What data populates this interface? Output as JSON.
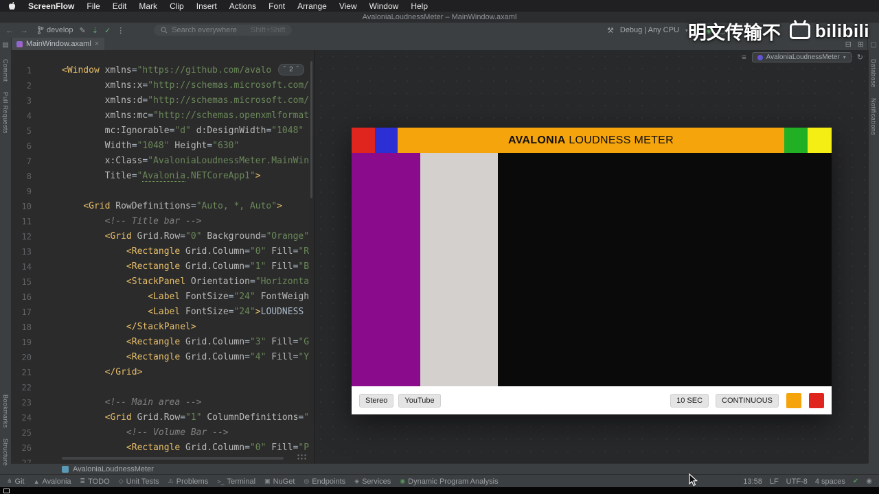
{
  "menubar": {
    "app": "ScreenFlow",
    "items": [
      "File",
      "Edit",
      "Mark",
      "Clip",
      "Insert",
      "Actions",
      "Font",
      "Arrange",
      "View",
      "Window",
      "Help"
    ]
  },
  "titlebar": {
    "title": "AvaloniaLoudnessMeter – MainWindow.axaml"
  },
  "toolbar": {
    "branch": "develop",
    "search_placeholder": "Search everywhere",
    "search_shortcut": "Shift+Shift",
    "run_config": "Debug | Any CPU"
  },
  "tab": {
    "label": "MainWindow.axaml",
    "close": "×"
  },
  "inspections": {
    "count": "2"
  },
  "strips": {
    "left_top": [
      "Commit",
      "Pull Requests"
    ],
    "left_bottom": [
      "Bookmarks",
      "Structure"
    ],
    "right": [
      "Database",
      "Notifications"
    ]
  },
  "preview": {
    "selector": "AvaloniaLoudnessMeter"
  },
  "breadcrumb": {
    "project": "AvaloniaLoudnessMeter"
  },
  "watermark": {
    "text": "明文传输不",
    "brand": "bilibili"
  },
  "statusbar": {
    "items": [
      {
        "icon": "⋔",
        "label": "Git"
      },
      {
        "icon": "▲",
        "label": "Avalonia"
      },
      {
        "icon": "≣",
        "label": "TODO"
      },
      {
        "icon": "◇",
        "label": "Unit Tests"
      },
      {
        "icon": "⚠",
        "label": "Problems"
      },
      {
        "icon": ">_",
        "label": "Terminal"
      },
      {
        "icon": "▣",
        "label": "NuGet"
      },
      {
        "icon": "◎",
        "label": "Endpoints"
      },
      {
        "icon": "◈",
        "label": "Services"
      },
      {
        "icon": "◉",
        "label": "Dynamic Program Analysis"
      }
    ],
    "time": "13:58",
    "line_ending": "LF",
    "encoding": "UTF-8",
    "indent": "4 spaces"
  },
  "app": {
    "title_strong": "AVALONIA",
    "title_rest": " LOUDNESS METER",
    "left_buttons": [
      "Stereo",
      "YouTube"
    ],
    "right_buttons": [
      "10 SEC",
      "CONTINUOUS"
    ],
    "colors": {
      "red": "#e0251f",
      "blue": "#2b2fd4",
      "orange": "#f5a40b",
      "green": "#21b024",
      "yellow": "#f4ee15",
      "purple": "#8a0c8d",
      "lightgray": "#d4d0cd",
      "black": "#0a0a0a"
    }
  },
  "code": {
    "lines": [
      {
        "n": "1",
        "t": [
          [
            "t",
            "<Window "
          ],
          [
            "a",
            "xmlns"
          ],
          [
            "p",
            "="
          ],
          [
            "s",
            "\"https://github.com/avalo"
          ]
        ]
      },
      {
        "n": "2",
        "t": [
          [
            "w",
            "        "
          ],
          [
            "a",
            "xmlns:x"
          ],
          [
            "p",
            "="
          ],
          [
            "s",
            "\"http://schemas.microsoft.com/"
          ]
        ]
      },
      {
        "n": "3",
        "t": [
          [
            "w",
            "        "
          ],
          [
            "a",
            "xmlns:d"
          ],
          [
            "p",
            "="
          ],
          [
            "s",
            "\"http://schemas.microsoft.com/"
          ]
        ]
      },
      {
        "n": "4",
        "t": [
          [
            "w",
            "        "
          ],
          [
            "a",
            "xmlns:mc"
          ],
          [
            "p",
            "="
          ],
          [
            "s",
            "\"http://schemas.openxmlformat"
          ]
        ]
      },
      {
        "n": "5",
        "t": [
          [
            "w",
            "        "
          ],
          [
            "a",
            "mc:Ignorable"
          ],
          [
            "p",
            "="
          ],
          [
            "s",
            "\"d\""
          ],
          [
            "w",
            " "
          ],
          [
            "a",
            "d:DesignWidth"
          ],
          [
            "p",
            "="
          ],
          [
            "s",
            "\"1048\""
          ]
        ]
      },
      {
        "n": "6",
        "t": [
          [
            "w",
            "        "
          ],
          [
            "a",
            "Width"
          ],
          [
            "p",
            "="
          ],
          [
            "s",
            "\"1048\""
          ],
          [
            "w",
            " "
          ],
          [
            "a",
            "Height"
          ],
          [
            "p",
            "="
          ],
          [
            "s",
            "\"630\""
          ]
        ]
      },
      {
        "n": "7",
        "t": [
          [
            "w",
            "        "
          ],
          [
            "a",
            "x:Class"
          ],
          [
            "p",
            "="
          ],
          [
            "s",
            "\"AvaloniaLoudnessMeter.MainWin"
          ]
        ]
      },
      {
        "n": "8",
        "t": [
          [
            "w",
            "        "
          ],
          [
            "a",
            "Title"
          ],
          [
            "p",
            "="
          ],
          [
            "s",
            "\""
          ],
          [
            "su",
            "Avalonia"
          ],
          [
            "s",
            ".NETCoreApp1\""
          ],
          [
            "t",
            ">"
          ]
        ]
      },
      {
        "n": "9",
        "t": []
      },
      {
        "n": "10",
        "t": [
          [
            "w",
            "    "
          ],
          [
            "t",
            "<Grid "
          ],
          [
            "a",
            "RowDefinitions"
          ],
          [
            "p",
            "="
          ],
          [
            "s",
            "\"Auto, *, Auto\""
          ],
          [
            "t",
            ">"
          ]
        ]
      },
      {
        "n": "11",
        "t": [
          [
            "w",
            "        "
          ],
          [
            "c",
            "<!-- Title bar -->"
          ]
        ]
      },
      {
        "n": "12",
        "t": [
          [
            "w",
            "        "
          ],
          [
            "t",
            "<Grid "
          ],
          [
            "a",
            "Grid.Row"
          ],
          [
            "p",
            "="
          ],
          [
            "s",
            "\"0\""
          ],
          [
            "w",
            " "
          ],
          [
            "a",
            "Background"
          ],
          [
            "p",
            "="
          ],
          [
            "s",
            "\"Orange\""
          ]
        ]
      },
      {
        "n": "13",
        "t": [
          [
            "w",
            "            "
          ],
          [
            "t",
            "<Rectangle "
          ],
          [
            "a",
            "Grid.Column"
          ],
          [
            "p",
            "="
          ],
          [
            "s",
            "\"0\""
          ],
          [
            "w",
            " "
          ],
          [
            "a",
            "Fill"
          ],
          [
            "p",
            "="
          ],
          [
            "s",
            "\"R"
          ]
        ]
      },
      {
        "n": "14",
        "t": [
          [
            "w",
            "            "
          ],
          [
            "t",
            "<Rectangle "
          ],
          [
            "a",
            "Grid.Column"
          ],
          [
            "p",
            "="
          ],
          [
            "s",
            "\"1\""
          ],
          [
            "w",
            " "
          ],
          [
            "a",
            "Fill"
          ],
          [
            "p",
            "="
          ],
          [
            "s",
            "\"B"
          ]
        ]
      },
      {
        "n": "15",
        "t": [
          [
            "w",
            "            "
          ],
          [
            "t",
            "<StackPanel "
          ],
          [
            "a",
            "Orientation"
          ],
          [
            "p",
            "="
          ],
          [
            "s",
            "\"Horizonta"
          ]
        ]
      },
      {
        "n": "16",
        "t": [
          [
            "w",
            "                "
          ],
          [
            "t",
            "<Label "
          ],
          [
            "a",
            "FontSize"
          ],
          [
            "p",
            "="
          ],
          [
            "s",
            "\"24\""
          ],
          [
            "w",
            " "
          ],
          [
            "a",
            "FontWeigh"
          ]
        ]
      },
      {
        "n": "17",
        "t": [
          [
            "w",
            "                "
          ],
          [
            "t",
            "<Label "
          ],
          [
            "a",
            "FontSize"
          ],
          [
            "p",
            "="
          ],
          [
            "s",
            "\"24\""
          ],
          [
            "t",
            ">"
          ],
          [
            "x",
            "LOUDNESS"
          ]
        ]
      },
      {
        "n": "18",
        "t": [
          [
            "w",
            "            "
          ],
          [
            "t",
            "</StackPanel>"
          ]
        ]
      },
      {
        "n": "19",
        "t": [
          [
            "w",
            "            "
          ],
          [
            "t",
            "<Rectangle "
          ],
          [
            "a",
            "Grid.Column"
          ],
          [
            "p",
            "="
          ],
          [
            "s",
            "\"3\""
          ],
          [
            "w",
            " "
          ],
          [
            "a",
            "Fill"
          ],
          [
            "p",
            "="
          ],
          [
            "s",
            "\"G"
          ]
        ]
      },
      {
        "n": "20",
        "t": [
          [
            "w",
            "            "
          ],
          [
            "t",
            "<Rectangle "
          ],
          [
            "a",
            "Grid.Column"
          ],
          [
            "p",
            "="
          ],
          [
            "s",
            "\"4\""
          ],
          [
            "w",
            " "
          ],
          [
            "a",
            "Fill"
          ],
          [
            "p",
            "="
          ],
          [
            "s",
            "\"Y"
          ]
        ]
      },
      {
        "n": "21",
        "t": [
          [
            "w",
            "        "
          ],
          [
            "t",
            "</Grid>"
          ]
        ]
      },
      {
        "n": "22",
        "t": []
      },
      {
        "n": "23",
        "t": [
          [
            "w",
            "        "
          ],
          [
            "c",
            "<!-- Main area -->"
          ]
        ]
      },
      {
        "n": "24",
        "t": [
          [
            "w",
            "        "
          ],
          [
            "t",
            "<Grid "
          ],
          [
            "a",
            "Grid.Row"
          ],
          [
            "p",
            "="
          ],
          [
            "s",
            "\"1\""
          ],
          [
            "w",
            " "
          ],
          [
            "a",
            "ColumnDefinitions"
          ],
          [
            "p",
            "="
          ],
          [
            "s",
            "\""
          ]
        ]
      },
      {
        "n": "25",
        "t": [
          [
            "w",
            "            "
          ],
          [
            "c",
            "<!-- Volume Bar -->"
          ]
        ]
      },
      {
        "n": "26",
        "t": [
          [
            "w",
            "            "
          ],
          [
            "t",
            "<Rectangle "
          ],
          [
            "a",
            "Grid.Column"
          ],
          [
            "p",
            "="
          ],
          [
            "s",
            "\"0\""
          ],
          [
            "w",
            " "
          ],
          [
            "a",
            "Fill"
          ],
          [
            "p",
            "="
          ],
          [
            "s",
            "\"P"
          ]
        ]
      },
      {
        "n": "27",
        "t": []
      }
    ]
  }
}
